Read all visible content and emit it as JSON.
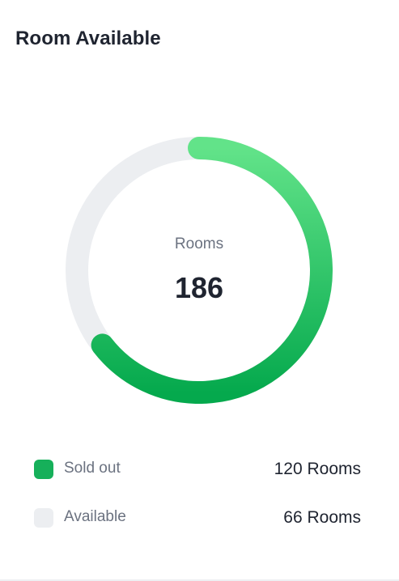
{
  "card": {
    "title": "Room Available"
  },
  "center": {
    "label": "Rooms",
    "value": "186"
  },
  "legend": [
    {
      "label": "Sold out",
      "value_text": "120 Rooms",
      "color": "#16b05a"
    },
    {
      "label": "Available",
      "value_text": "66 Rooms",
      "color": "#eceef1"
    }
  ],
  "chart_data": {
    "type": "pie",
    "title": "Room Available",
    "total": 186,
    "series": [
      {
        "name": "Sold out",
        "value": 120,
        "color_start": "#62e389",
        "color_end": "#05a94d"
      },
      {
        "name": "Available",
        "value": 66,
        "color": "#eceef1"
      }
    ]
  }
}
